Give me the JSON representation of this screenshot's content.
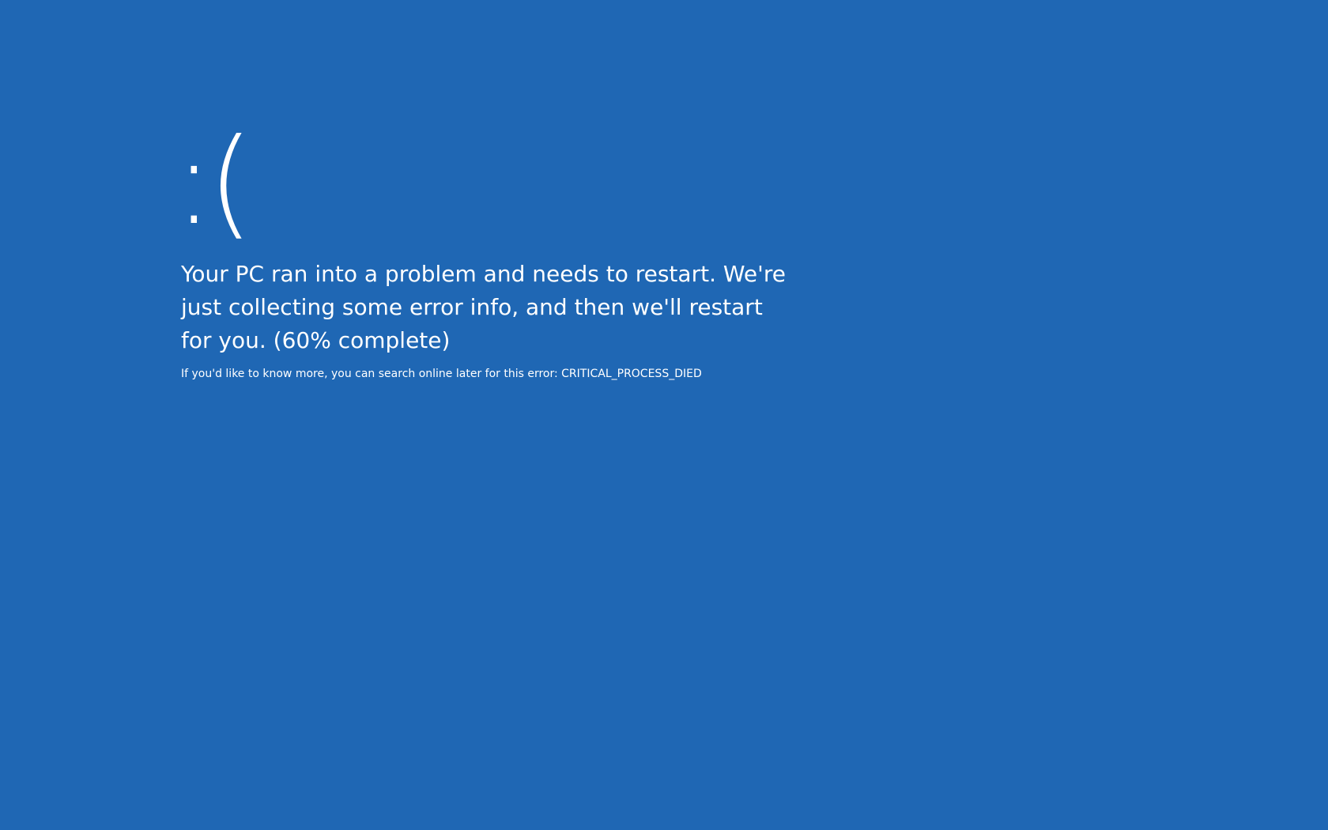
{
  "screen": {
    "background_color": "#1f67b4",
    "text_color": "#ffffff",
    "face": ":(",
    "message": "Your PC ran into a problem and needs to restart. We're just collecting some error info, and then we'll restart for you.",
    "progress_text": "(60% complete)",
    "progress_percent": 60,
    "detail_prefix": "If you'd like to know more, you can search online later for this error: ",
    "stop_code": "CRITICAL_PROCESS_DIED"
  }
}
